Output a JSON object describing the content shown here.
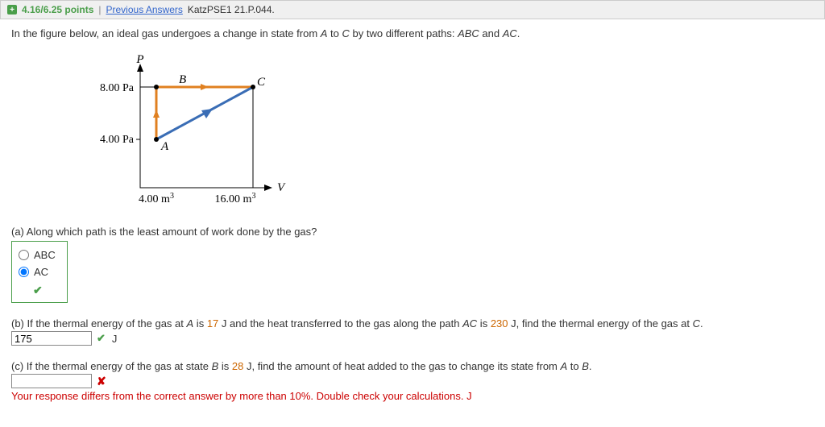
{
  "header": {
    "points": "4.16/6.25 points",
    "prev_link": "Previous Answers",
    "reference": "KatzPSE1 21.P.044."
  },
  "statement": {
    "pre": "In the figure below, an ideal gas undergoes a change in state from ",
    "A": "A",
    "mid1": " to ",
    "C": "C",
    "mid2": " by two different paths: ",
    "ABC": "ABC",
    "mid3": " and ",
    "AC": "AC",
    "post": "."
  },
  "figure": {
    "p_label": "P",
    "v_label": "V",
    "A": "A",
    "B": "B",
    "C": "C",
    "p8": "8.00 Pa",
    "p4": "4.00 Pa",
    "v4": "4.00 m",
    "v16": "16.00 m",
    "cubed": "3"
  },
  "part_a": {
    "question": "(a) Along which path is the least amount of work done by the gas?",
    "opt1": "ABC",
    "opt2": "AC"
  },
  "part_b": {
    "pre": "(b) If the thermal energy of the gas at ",
    "A": "A",
    "mid1": " is ",
    "v1": "17",
    "j1": " J",
    "mid2": " and the heat transferred to the gas along the path ",
    "AC": "AC",
    "mid3": " is ",
    "v2": "230",
    "j2": " J",
    "mid4": ", find the thermal energy of the gas at ",
    "C": "C",
    "post": ".",
    "answer": "175",
    "unit": "J"
  },
  "part_c": {
    "pre": "(c) If the thermal energy of the gas at state ",
    "B": "B",
    "mid1": " is ",
    "v1": "28",
    "j1": " J",
    "mid2": ", find the amount of heat added to the gas to change its state from ",
    "A": "A",
    "mid3": " to ",
    "B2": "B",
    "post": ".",
    "answer": "",
    "feedback": "Your response differs from the correct answer by more than 10%. Double check your calculations.",
    "unit": "J"
  },
  "chart_data": {
    "type": "line",
    "title": "",
    "xlabel": "V",
    "ylabel": "P",
    "xticks": [
      {
        "value": 4.0,
        "label": "4.00 m³"
      },
      {
        "value": 16.0,
        "label": "16.00 m³"
      }
    ],
    "yticks": [
      {
        "value": 4.0,
        "label": "4.00 Pa"
      },
      {
        "value": 8.0,
        "label": "8.00 Pa"
      }
    ],
    "points": {
      "A": {
        "V": 4.0,
        "P": 4.0
      },
      "B": {
        "V": 4.0,
        "P": 8.0
      },
      "C": {
        "V": 16.0,
        "P": 8.0
      }
    },
    "paths": [
      {
        "name": "AB",
        "from": "A",
        "to": "B",
        "color": "orange"
      },
      {
        "name": "BC",
        "from": "B",
        "to": "C",
        "color": "orange"
      },
      {
        "name": "AC",
        "from": "A",
        "to": "C",
        "color": "blue"
      }
    ],
    "xlim": [
      0,
      18
    ],
    "ylim": [
      0,
      10
    ]
  }
}
